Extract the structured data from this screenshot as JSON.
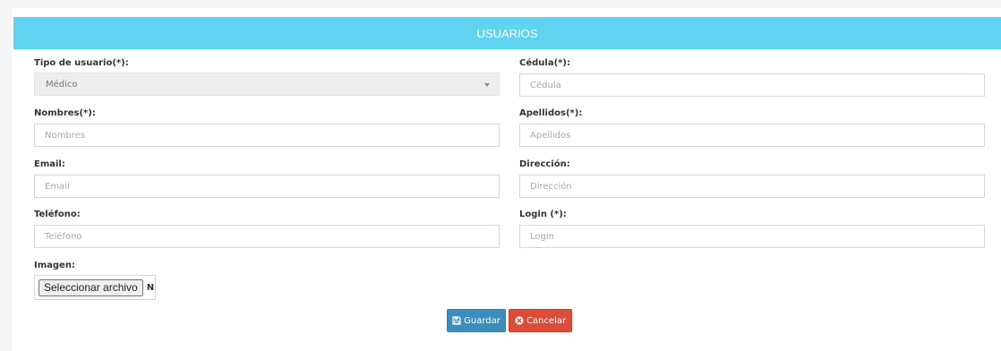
{
  "header": {
    "title": "USUARIOS"
  },
  "form": {
    "tipo_usuario": {
      "label": "Tipo de usuario(*):",
      "value": "Médico"
    },
    "cedula": {
      "label": "Cédula(*):",
      "placeholder": "Cédula"
    },
    "nombres": {
      "label": "Nombres(*):",
      "placeholder": "Nombres"
    },
    "apellidos": {
      "label": "Apellidos(*):",
      "placeholder": "Apellidos"
    },
    "email": {
      "label": "Email:",
      "placeholder": "Email"
    },
    "direccion": {
      "label": "Dirección:",
      "placeholder": "Dirección"
    },
    "telefono": {
      "label": "Teléfono:",
      "placeholder": "Teléfono"
    },
    "login": {
      "label": "Login (*):",
      "placeholder": "Login"
    },
    "imagen": {
      "label": "Imagen:",
      "button_label": "Seleccionar archivo",
      "status": "Nin"
    }
  },
  "actions": {
    "save_label": "Guardar",
    "cancel_label": "Cancelar"
  },
  "colors": {
    "header": "#5fd3ef",
    "save": "#3c8dbc",
    "cancel": "#dd4b39"
  },
  "icons": {
    "save": "floppy-disk-icon",
    "cancel": "times-circle-icon",
    "select": "caret-down-icon"
  }
}
